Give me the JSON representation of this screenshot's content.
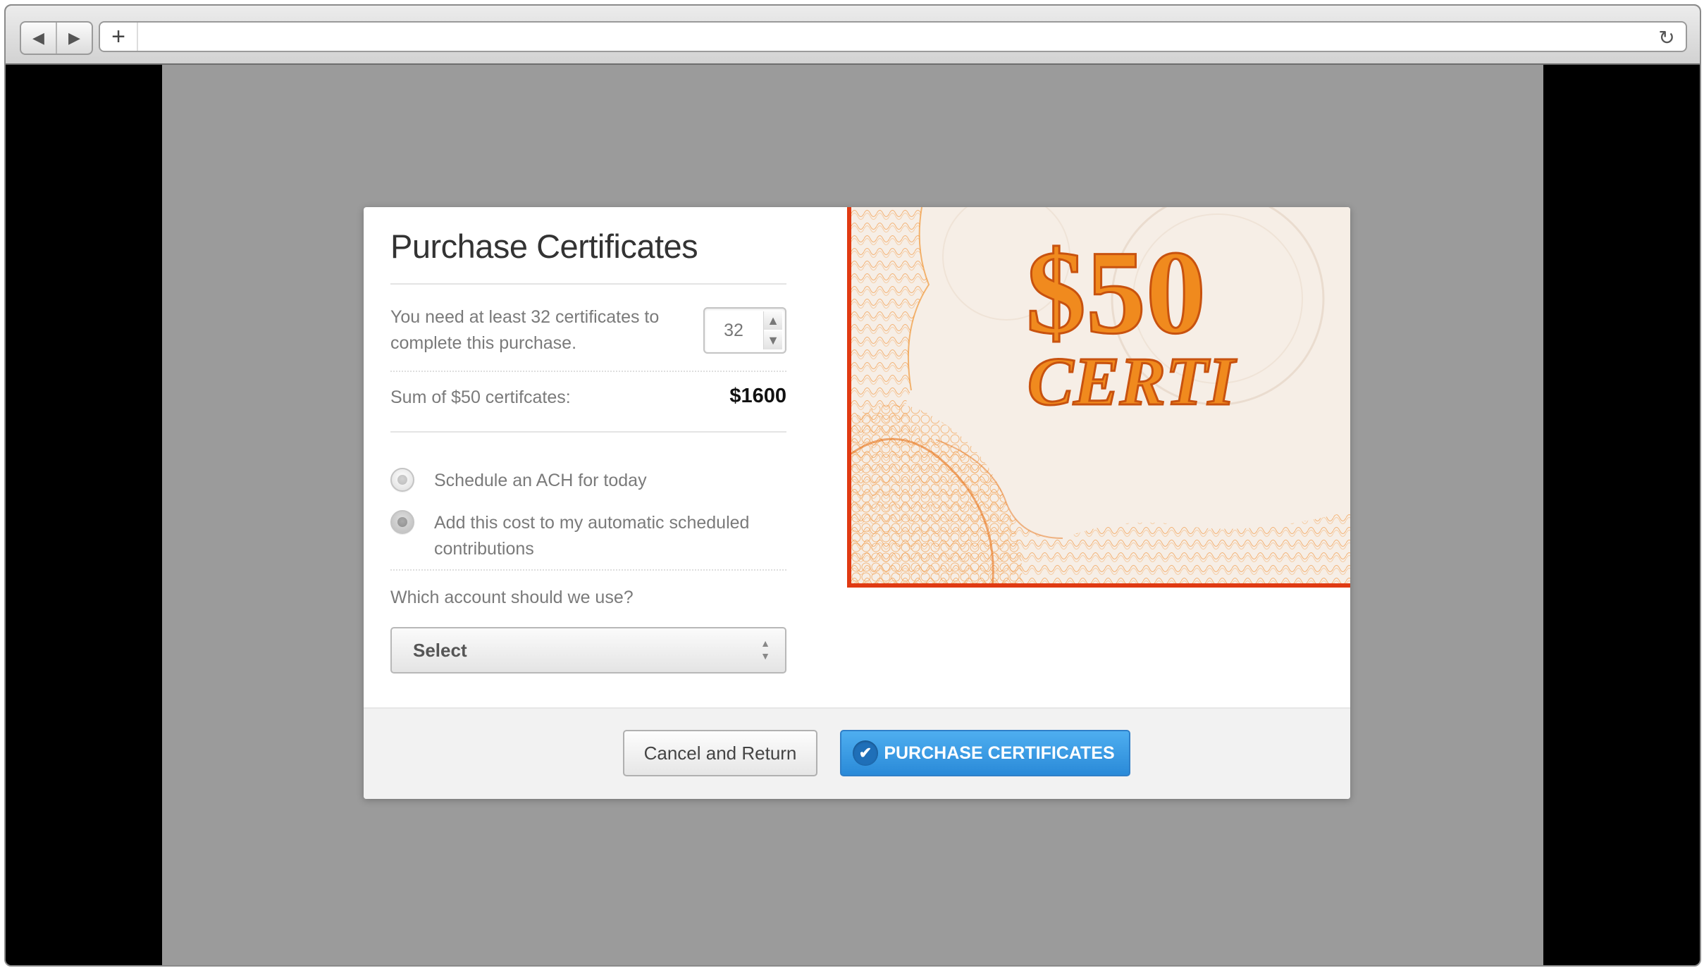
{
  "browser": {
    "back_icon": "◀",
    "forward_icon": "▶",
    "new_tab_icon": "+",
    "reload_icon": "↻",
    "url": ""
  },
  "modal": {
    "title": "Purchase Certificates",
    "need_text": "You need at least 32 certificates to complete this purchase.",
    "quantity": "32",
    "sum_label": "Sum of $50 certifcates:",
    "sum_value": "$1600",
    "options": [
      {
        "label": "Schedule an ACH for today",
        "selected": false
      },
      {
        "label": "Add this cost to my automatic scheduled contributions",
        "selected": true
      }
    ],
    "account_question": "Which account should we use?",
    "account_select_value": "Select",
    "certificate": {
      "amount_text": "$50",
      "word_text": "CERTI",
      "border_color": "#e03a12",
      "ink_color": "#f08a1e"
    }
  },
  "footer": {
    "cancel_label": "Cancel and Return",
    "purchase_label": "PURCHASE CERTIFICATES"
  },
  "colors": {
    "overlay": "#9b9b9b",
    "primary_button": "#2a8ad8"
  }
}
